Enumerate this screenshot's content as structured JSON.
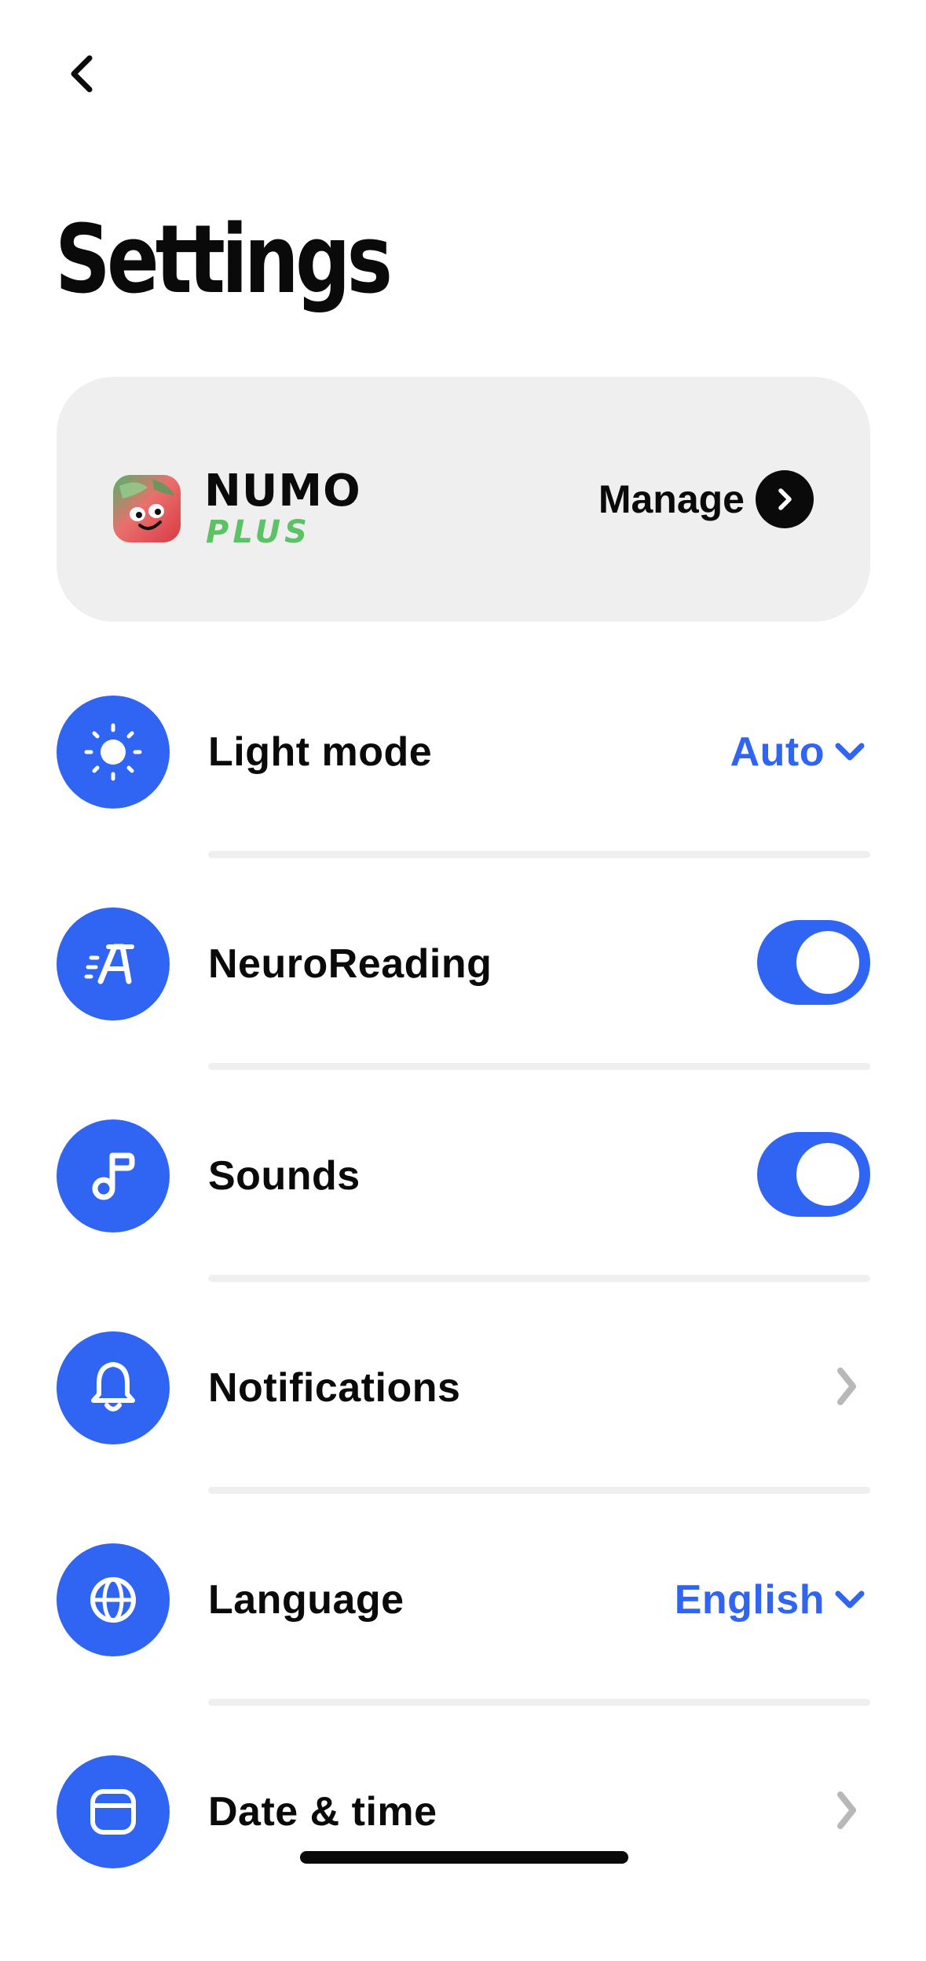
{
  "navigation": {
    "back_icon": "chevron-left-icon"
  },
  "page": {
    "title": "Settings"
  },
  "plus_card": {
    "logo_icon": "numo-mascot-logo",
    "brand_name": "NUMO",
    "brand_tier": "PLUS",
    "manage_label": "Manage",
    "manage_icon": "chevron-right-circle-icon"
  },
  "settings": [
    {
      "key": "light_mode",
      "icon": "sun-icon",
      "label": "Light mode",
      "control": "select",
      "value": "Auto"
    },
    {
      "key": "neuroreading",
      "icon": "neuroreading-icon",
      "label": "NeuroReading",
      "control": "toggle",
      "enabled": true
    },
    {
      "key": "sounds",
      "icon": "music-note-icon",
      "label": "Sounds",
      "control": "toggle",
      "enabled": true
    },
    {
      "key": "notifications",
      "icon": "bell-icon",
      "label": "Notifications",
      "control": "link"
    },
    {
      "key": "language",
      "icon": "globe-icon",
      "label": "Language",
      "control": "select",
      "value": "English"
    },
    {
      "key": "date_time",
      "icon": "calendar-icon",
      "label": "Date & time",
      "control": "link"
    }
  ],
  "colors": {
    "accent": "#2f65f2",
    "card_background": "#efefef",
    "plus_green": "#5cc265",
    "text_primary": "#0a0a0a",
    "chevron_gray": "#b8b8b8"
  }
}
